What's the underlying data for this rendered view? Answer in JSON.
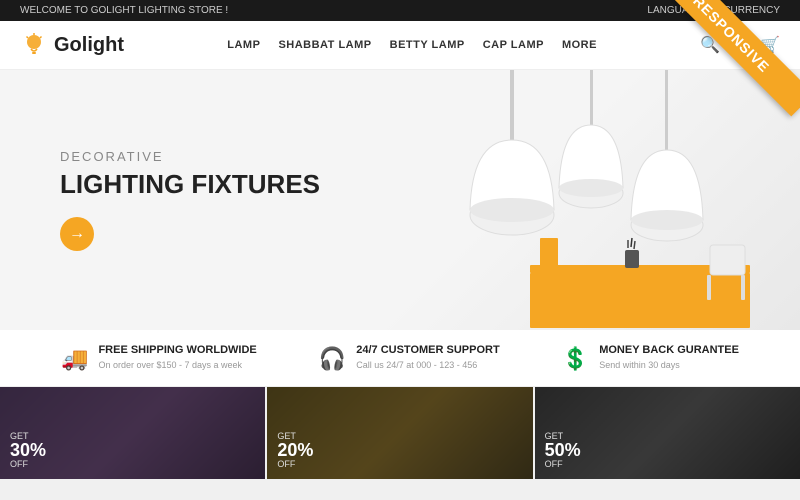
{
  "topbar": {
    "welcome_text": "WELCOME TO GOLIGHT LIGHTING STORE !",
    "language_label": "LANGUAGE",
    "currency_label": "$ CURRENCY"
  },
  "header": {
    "logo_text": "Golight",
    "nav_items": [
      "LAMP",
      "SHABBAT LAMP",
      "BETTY LAMP",
      "CAP LAMP",
      "MORE"
    ]
  },
  "hero": {
    "subtitle": "DECORATIVE",
    "title": "LIGHTING FIXTURES",
    "cta_arrow": "→"
  },
  "features": [
    {
      "icon": "🚚",
      "title": "FREE SHIPPING WORLDWIDE",
      "desc": "On order over $150 - 7 days a week"
    },
    {
      "icon": "🎧",
      "title": "24/7 CUSTOMER SUPPORT",
      "desc": "Call us 24/7 at 000 - 123 - 456"
    },
    {
      "icon": "💲",
      "title": "MONEY BACK GURANTEE",
      "desc": "Send within 30 days"
    }
  ],
  "products": [
    {
      "get": "GET",
      "discount": "30%",
      "off": "OFF"
    },
    {
      "get": "GET",
      "discount": "20%",
      "off": "OFF"
    },
    {
      "get": "GET",
      "discount": "50%",
      "off": "OFF"
    }
  ],
  "badge": {
    "text": "RESPONSIVE"
  }
}
